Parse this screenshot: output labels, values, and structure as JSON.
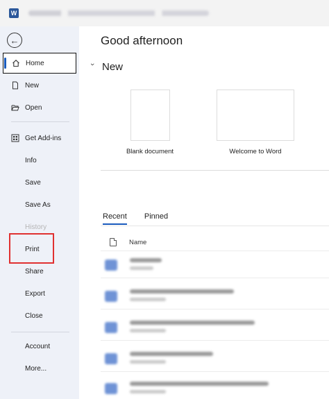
{
  "app": {
    "logo_letter": "W"
  },
  "sidebar": {
    "back_icon": "arrow-left-icon",
    "items": [
      {
        "label": "Home",
        "icon": "home-icon"
      },
      {
        "label": "New",
        "icon": "new-document-icon"
      },
      {
        "label": "Open",
        "icon": "folder-open-icon"
      },
      {
        "label": "Get Add-ins",
        "icon": "grid-icon"
      },
      {
        "label": "Info"
      },
      {
        "label": "Save"
      },
      {
        "label": "Save As"
      },
      {
        "label": "History"
      },
      {
        "label": "Print"
      },
      {
        "label": "Share"
      },
      {
        "label": "Export"
      },
      {
        "label": "Close"
      },
      {
        "label": "Account"
      },
      {
        "label": "More..."
      }
    ]
  },
  "main": {
    "greeting": "Good afternoon",
    "new_section": {
      "label": "New",
      "chevron_icon": "chevron-down-icon"
    },
    "templates": [
      {
        "label": "Blank document"
      },
      {
        "label": "Welcome to Word"
      }
    ],
    "tabs": [
      {
        "label": "Recent"
      },
      {
        "label": "Pinned"
      }
    ],
    "list_header": {
      "name": "Name",
      "icon": "file-icon"
    }
  },
  "colors": {
    "accent": "#185abd",
    "sidebar_bg": "#eef1f8",
    "highlight": "#e03030",
    "word_blue": "#2b579a"
  }
}
